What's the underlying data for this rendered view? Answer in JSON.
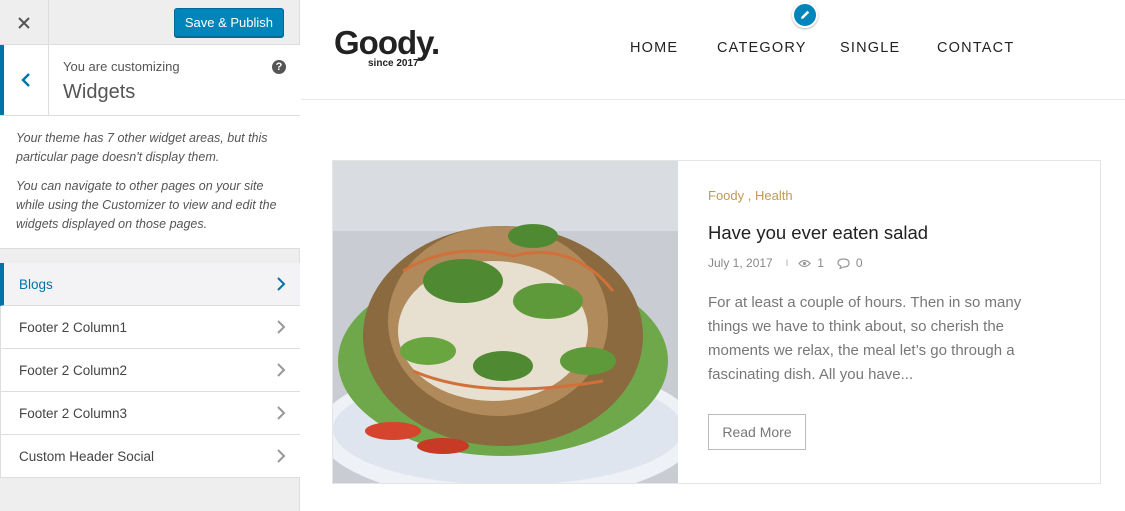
{
  "sidebar": {
    "save_label": "Save & Publish",
    "customizing_label": "You are customizing",
    "section_title": "Widgets",
    "help_label": "?",
    "notice": [
      "Your theme has 7 other widget areas, but this particular page doesn't display them.",
      "You can navigate to other pages on your site while using the Customizer to view and edit the widgets displayed on those pages."
    ],
    "widget_areas": [
      {
        "label": "Blogs",
        "active": true
      },
      {
        "label": "Footer 2 Column1",
        "active": false
      },
      {
        "label": "Footer 2 Column2",
        "active": false
      },
      {
        "label": "Footer 2 Column3",
        "active": false
      },
      {
        "label": "Custom Header Social",
        "active": false
      }
    ],
    "accent_color": "#0073aa",
    "button_color": "#0085ba"
  },
  "site": {
    "logo": "Goody.",
    "logo_sub": "since 2017",
    "nav": [
      "HOME",
      "CATEGORY",
      "SINGLE",
      "CONTACT"
    ]
  },
  "post": {
    "categories": [
      "Foody",
      "Health"
    ],
    "category_color": "#c19a50",
    "title": "Have you ever eaten salad",
    "date": "July 1, 2017",
    "separator": "I",
    "views": "1",
    "comments": "0",
    "excerpt": "For at least a couple of hours. Then in so many things we have to think about, so cherish the moments we relax, the meal let’s go through a fascinating dish. All you have...",
    "read_more": "Read More"
  }
}
